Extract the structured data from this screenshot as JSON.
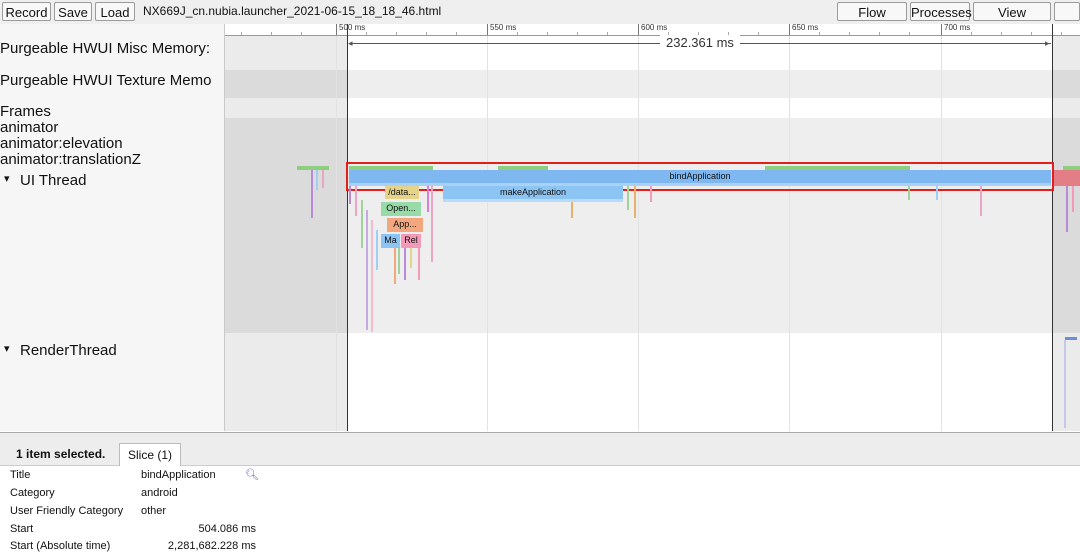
{
  "toolbar": {
    "record": "Record",
    "save": "Save",
    "load": "Load",
    "filename": "NX669J_cn.nubia.launcher_2021-06-15_18_18_46.html",
    "flow_events": "Flow events",
    "processes": "Processes",
    "view_options": "View Options"
  },
  "ruler": {
    "ticks": [
      "500 ms",
      "550 ms",
      "600 ms",
      "650 ms",
      "700 ms"
    ],
    "selection_duration": "232.361 ms"
  },
  "tracks": {
    "misc_memory": "Purgeable HWUI Misc Memory:",
    "texture_memory": "Purgeable HWUI Texture Memo",
    "frames": "Frames",
    "animator": "animator",
    "animator_elevation": "animator:elevation",
    "animator_translationz": "animator:translationZ",
    "ui_thread": "UI Thread",
    "render_thread": "RenderThread",
    "expand_glyph": "▾"
  },
  "slices": {
    "bind_application": "bindApplication",
    "make_application": "makeApplication",
    "data": "/data...",
    "open": "Open...",
    "app": "App...",
    "ma": "Ma",
    "rel": "Rel"
  },
  "panel": {
    "selected": "1 item selected.",
    "tab_slice": "Slice (1)",
    "rows": [
      {
        "key": "Title",
        "value": "bindApplication"
      },
      {
        "key": "Category",
        "value": "android"
      },
      {
        "key": "User Friendly Category",
        "value": "other"
      },
      {
        "key": "Start",
        "value": "504.086 ms"
      },
      {
        "key": "Start (Absolute time)",
        "value": "2,281,682.228 ms"
      }
    ]
  },
  "colors": {
    "bind_application": "#7fb8f0",
    "make_application": "#8cc4f4",
    "highlight_box": "#e0201b",
    "selection_line": "#333333"
  }
}
